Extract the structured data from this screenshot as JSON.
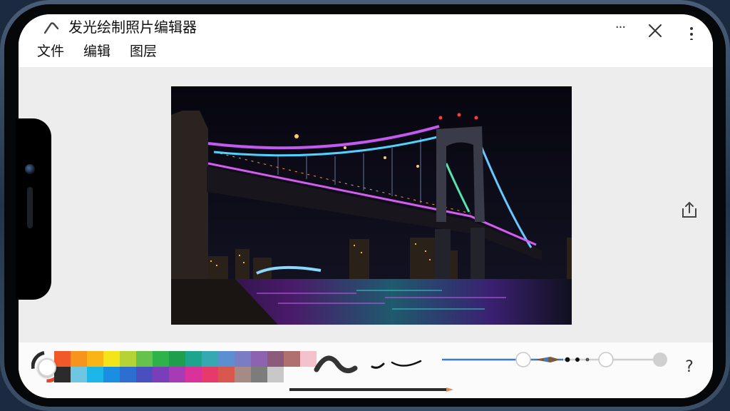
{
  "app": {
    "title": "发光绘制照片编辑器"
  },
  "menu": {
    "items": [
      {
        "label": "文件"
      },
      {
        "label": "编辑"
      },
      {
        "label": "图层"
      }
    ]
  },
  "window_controls": {
    "more_horizontal": "···"
  },
  "palette": {
    "current_color": "#ffffff",
    "row1": [
      "#f05a28",
      "#f7941d",
      "#fbb415",
      "#f4e51a",
      "#b5d334",
      "#66c24a",
      "#2db34a",
      "#1f9e4e",
      "#1da48c",
      "#34a9b2",
      "#5b8fcf",
      "#7a7cc4",
      "#8d63b0",
      "#8c5a7a",
      "#b07070",
      "#f4c2cc"
    ],
    "row2": [
      "#2b2b2b",
      "#6ec6e0",
      "#1cb6e8",
      "#1a8ee0",
      "#2c6fd1",
      "#4a4fc0",
      "#7a3fb8",
      "#a73ab5",
      "#d9329a",
      "#e53a6b",
      "#d8574f",
      "#a58a86",
      "#7c7c7c",
      "#c8c8c8"
    ]
  },
  "brush": {
    "size_value": 0.34,
    "opacity_value": 0.74
  },
  "help": {
    "label": "?"
  },
  "icons": {
    "logo": "app-logo-icon",
    "more_h": "more-horizontal-icon",
    "close": "close-icon",
    "more_v": "more-vertical-icon",
    "export": "export-icon",
    "help": "help-icon"
  }
}
